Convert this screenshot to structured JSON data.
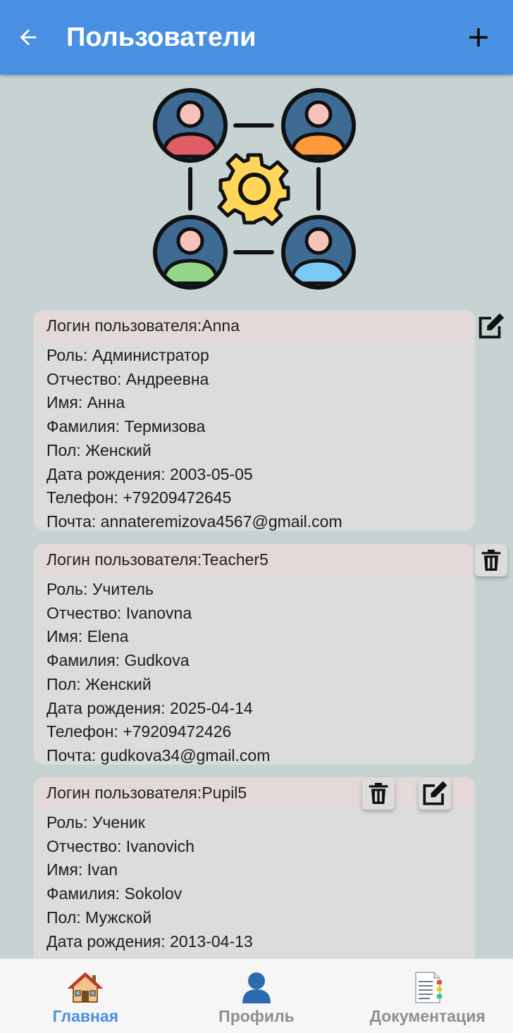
{
  "appbar": {
    "title": "Пользователи",
    "back_icon": "arrow-left-icon",
    "add_icon": "plus-icon",
    "background": "#4a90e2"
  },
  "illustration": {
    "icon": "users-network-gear-icon",
    "colors": [
      "#e05c66",
      "#ff9a3c",
      "#94d68a",
      "#7cc8f5",
      "#ffd65a"
    ]
  },
  "labels": {
    "login": "Логин пользователя: ",
    "role": "Роль: ",
    "patronymic": "Отчество: ",
    "first_name": "Имя: ",
    "last_name": "Фамилия: ",
    "gender": "Пол: ",
    "birth_date": "Дата рождения: ",
    "phone": "Телефон: ",
    "email": "Почта: "
  },
  "users": [
    {
      "login": "Anna",
      "role": "Администратор",
      "patronymic": "Андреевна",
      "first_name": "Анна",
      "last_name": "Термизова",
      "gender": "Женский",
      "birth_date": "2003-05-05",
      "phone": "+79209472645",
      "email": "annateremizova4567@gmail.com",
      "actions": [
        "edit"
      ]
    },
    {
      "login": "Teacher5",
      "role": "Учитель",
      "patronymic": "Ivanovna",
      "first_name": "Elena",
      "last_name": "Gudkova",
      "gender": "Женский",
      "birth_date": "2025-04-14",
      "phone": "+79209472426",
      "email": "gudkova34@gmail.com",
      "actions": [
        "delete"
      ]
    },
    {
      "login": "Pupil5",
      "role": "Ученик",
      "patronymic": "Ivanovich",
      "first_name": "Ivan",
      "last_name": "Sokolov",
      "gender": "Мужской",
      "birth_date": "2013-04-13",
      "phone": "",
      "email": "",
      "actions": [
        "delete",
        "edit"
      ]
    }
  ],
  "bottom_nav": [
    {
      "label": "Главная",
      "icon": "house-icon",
      "active": true
    },
    {
      "label": "Профиль",
      "icon": "person-silhouette-icon",
      "active": false
    },
    {
      "label": "Документация",
      "icon": "document-icon",
      "active": false
    }
  ],
  "colors": {
    "accent": "#4a90e2",
    "inactive_nav": "#8f8f8f",
    "card": "#dcdcdc",
    "card_header": "#e3d9d9",
    "page_bg": "#c7d3d3"
  }
}
